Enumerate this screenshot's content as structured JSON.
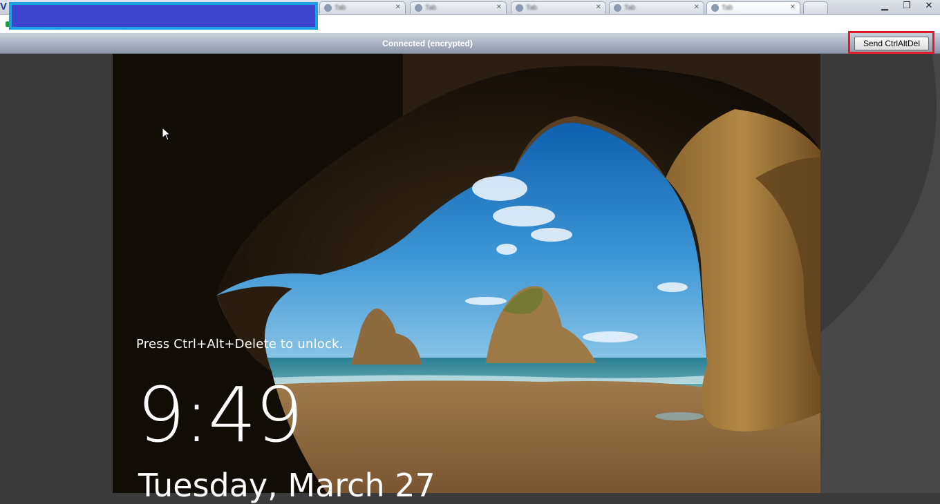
{
  "browser": {
    "app_letter": "V",
    "tabs": [
      {
        "title": "Tab",
        "close": "✕"
      },
      {
        "title": "Tab",
        "close": "✕"
      },
      {
        "title": "Tab",
        "close": "✕"
      },
      {
        "title": "Tab",
        "close": "✕"
      },
      {
        "title": "Tab",
        "close": "✕"
      }
    ],
    "window_controls": {
      "minimize": "▁",
      "restore": "❐",
      "close": "✕"
    }
  },
  "vnc": {
    "status": "Connected (encrypted)",
    "ctrl_alt_del_label": "Send CtrlAltDel"
  },
  "lockscreen": {
    "unlock_prompt": "Press Ctrl+Alt+Delete to unlock.",
    "time": "9:49",
    "date": "Tuesday, March 27"
  },
  "colors": {
    "redaction_fill": "#3f45cf",
    "redaction_border": "#1e9fe6",
    "highlight_border": "#e01b2a"
  }
}
